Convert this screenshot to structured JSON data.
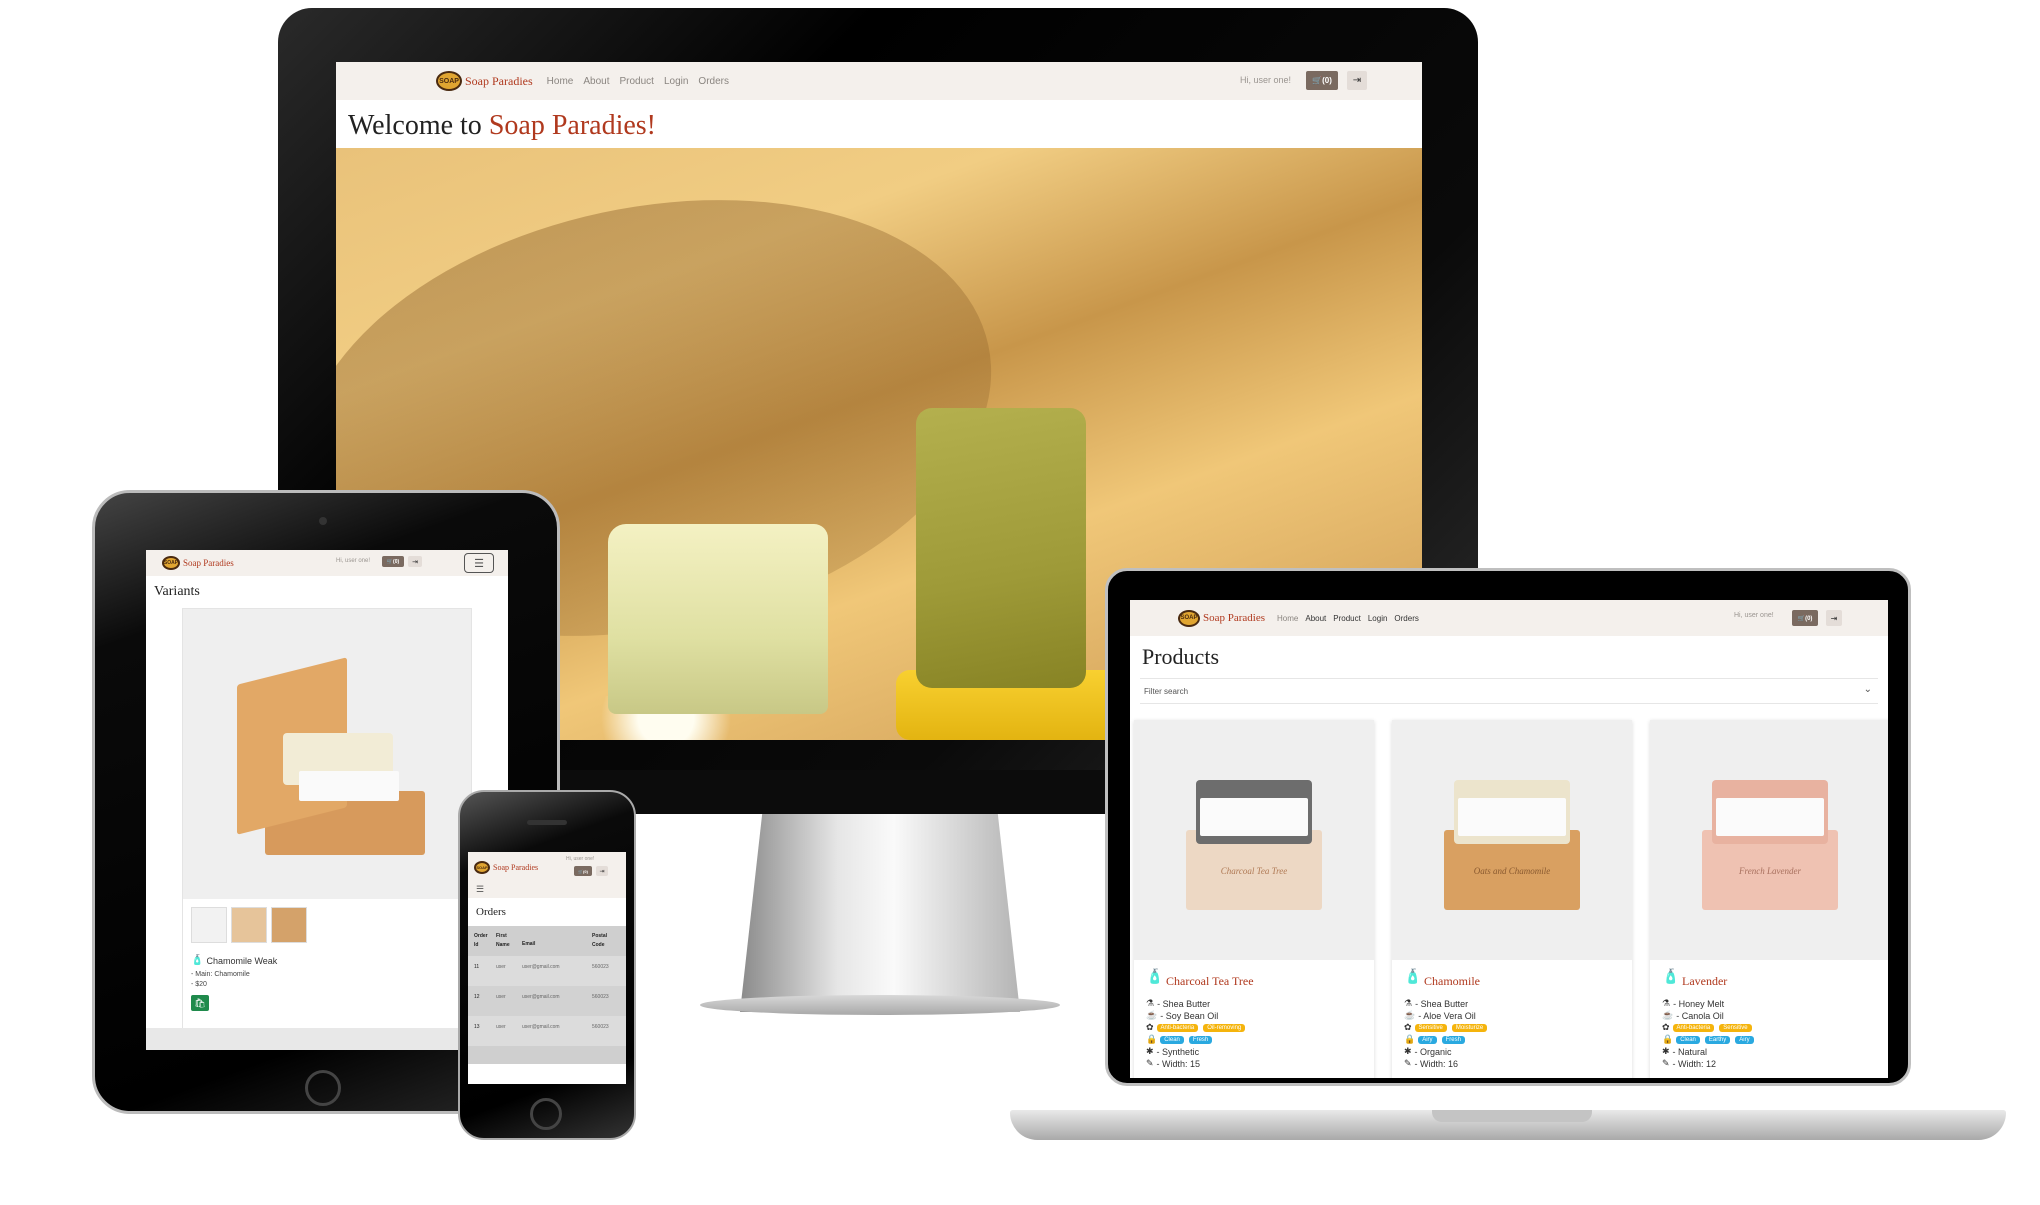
{
  "brand": {
    "logo_text": "SOAP",
    "name": "Soap Paradies"
  },
  "nav": {
    "links": [
      "Home",
      "About",
      "Product",
      "Login",
      "Orders"
    ],
    "greeting": "Hi, user one!",
    "cart": "🛒(0)",
    "logout_icon": "⇥"
  },
  "desktop": {
    "heading_prefix": "Welcome to ",
    "heading_brand": "Soap Paradies!"
  },
  "tablet": {
    "cart": "🛒(0)",
    "heading": "Variants",
    "variant_name": "Chamomile Weak",
    "main_line": "- Main: Chamomile",
    "price_line": "- $20"
  },
  "phone": {
    "cart": "🛒(0)",
    "heading": "Orders",
    "columns": [
      "Order Id",
      "First Name",
      "Email",
      "Postal Code"
    ],
    "rows": [
      [
        "11",
        "user",
        "user@gmail.com",
        "560023"
      ],
      [
        "12",
        "user",
        "user@gmail.com",
        "560023"
      ],
      [
        "13",
        "user",
        "user@gmail.com",
        "560023"
      ]
    ]
  },
  "laptop": {
    "heading": "Products",
    "filter_placeholder": "Filter search",
    "products": [
      {
        "name": "Charcoal Tea Tree",
        "base": "- Shea Butter",
        "oil": "- Soy Bean Oil",
        "tags1": [
          "Anti-bacteria",
          "Oil-removing"
        ],
        "tags2": [
          "Clean",
          "Fresh"
        ],
        "fragrance": "- Synthetic",
        "width": "- Width: 15",
        "box_label": "Charcoal Tea Tree"
      },
      {
        "name": "Chamomile",
        "base": "- Shea Butter",
        "oil": "- Aloe Vera Oil",
        "tags1": [
          "Sensitive",
          "Moisturize"
        ],
        "tags2": [
          "Airy",
          "Fresh"
        ],
        "fragrance": "- Organic",
        "width": "- Width: 16",
        "box_label": "Oats and Chamomile"
      },
      {
        "name": "Lavender",
        "base": "- Honey Melt",
        "oil": "- Canola Oil",
        "tags1": [
          "Anti-bacteria",
          "Sensitive"
        ],
        "tags2": [
          "Clean",
          "Earthy",
          "Airy"
        ],
        "fragrance": "- Natural",
        "width": "- Width: 12",
        "box_label": "French Lavender"
      }
    ]
  },
  "colors": {
    "brand_red": "#b0391e",
    "nav_bg": "#f4f0ec",
    "tag_yellow": "#f5b40c",
    "tag_blue": "#2aa9e0",
    "add_green": "#1f8a4c"
  }
}
